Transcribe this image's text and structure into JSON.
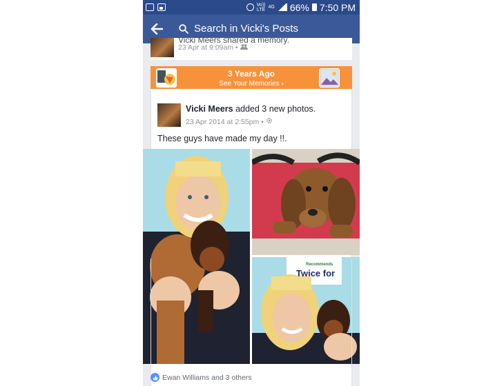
{
  "status_bar": {
    "signal_label_top": "Vo))",
    "signal_label_bottom": "LTE",
    "network": "4G",
    "battery": "66%",
    "time": "7:50 PM"
  },
  "app_bar": {
    "back_icon": "back-arrow-icon",
    "search_icon": "search-icon",
    "search_text": "Search in Vicki's Posts"
  },
  "previous_post": {
    "name": "Vicki Meers",
    "action": "shared a memory.",
    "date": "23 Apr at 9:09am",
    "separator": "•",
    "audience_icon": "friends-icon"
  },
  "memory_banner": {
    "title": "3 Years Ago",
    "link": "See Your Memories ›"
  },
  "post": {
    "author": "Vicki Meers",
    "action": "added 3 new photos.",
    "date": "23 Apr 2014 at 2:55pm",
    "separator": "•",
    "audience_icon": "settings-icon",
    "text": "These guys have made my day !!.",
    "photos": [
      {
        "subject": "woman-holding-two-puppies"
      },
      {
        "subject": "puppy-on-red-bag"
      },
      {
        "subject": "woman-with-puppy"
      }
    ],
    "sign_text_line1": "Recommends",
    "sign_text_line2": "Twice for"
  },
  "likes": {
    "icon": "like-icon",
    "text": "Ewan Williams and 3 others",
    "color": "#5890ff"
  },
  "colors": {
    "status_bar": "#2b4a8b",
    "app_bar": "#3b5998",
    "memory_banner": "#f7923a"
  }
}
